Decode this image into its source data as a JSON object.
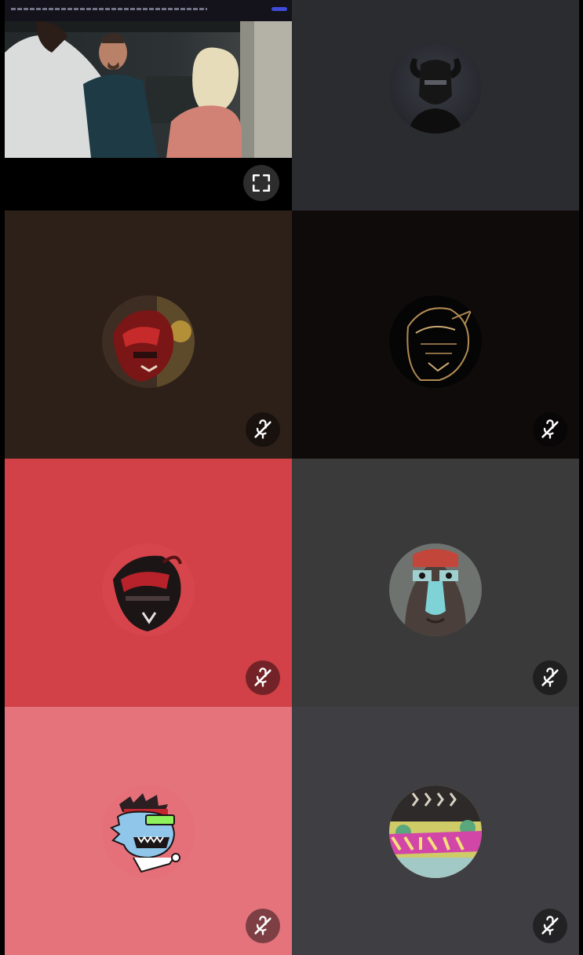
{
  "tiles": [
    {
      "id": "screen-share",
      "bg": "#000000",
      "type": "stream"
    },
    {
      "id": "participant-1",
      "bg": "#2b2c30",
      "avatar": "dark-bull-helmet",
      "muted": false
    },
    {
      "id": "participant-2",
      "bg": "#2d2019",
      "avatar": "red-armored-helmet",
      "muted": true
    },
    {
      "id": "participant-3",
      "bg": "#100b0b",
      "avatar": "gold-outline-helmet",
      "muted": true
    },
    {
      "id": "participant-4",
      "bg": "#d14147",
      "avatar": "red-black-helmet",
      "muted": true
    },
    {
      "id": "participant-5",
      "bg": "#3b3a3b",
      "avatar": "face-paint-portrait",
      "muted": true
    },
    {
      "id": "participant-6",
      "bg": "#e4737c",
      "avatar": "pixel-shark-vr",
      "muted": true
    },
    {
      "id": "participant-7",
      "bg": "#3f3f43",
      "avatar": "colorful-graffiti",
      "muted": true
    }
  ],
  "icons": {
    "mute": "microphone-muted-icon",
    "fullscreen": "fullscreen-icon"
  }
}
